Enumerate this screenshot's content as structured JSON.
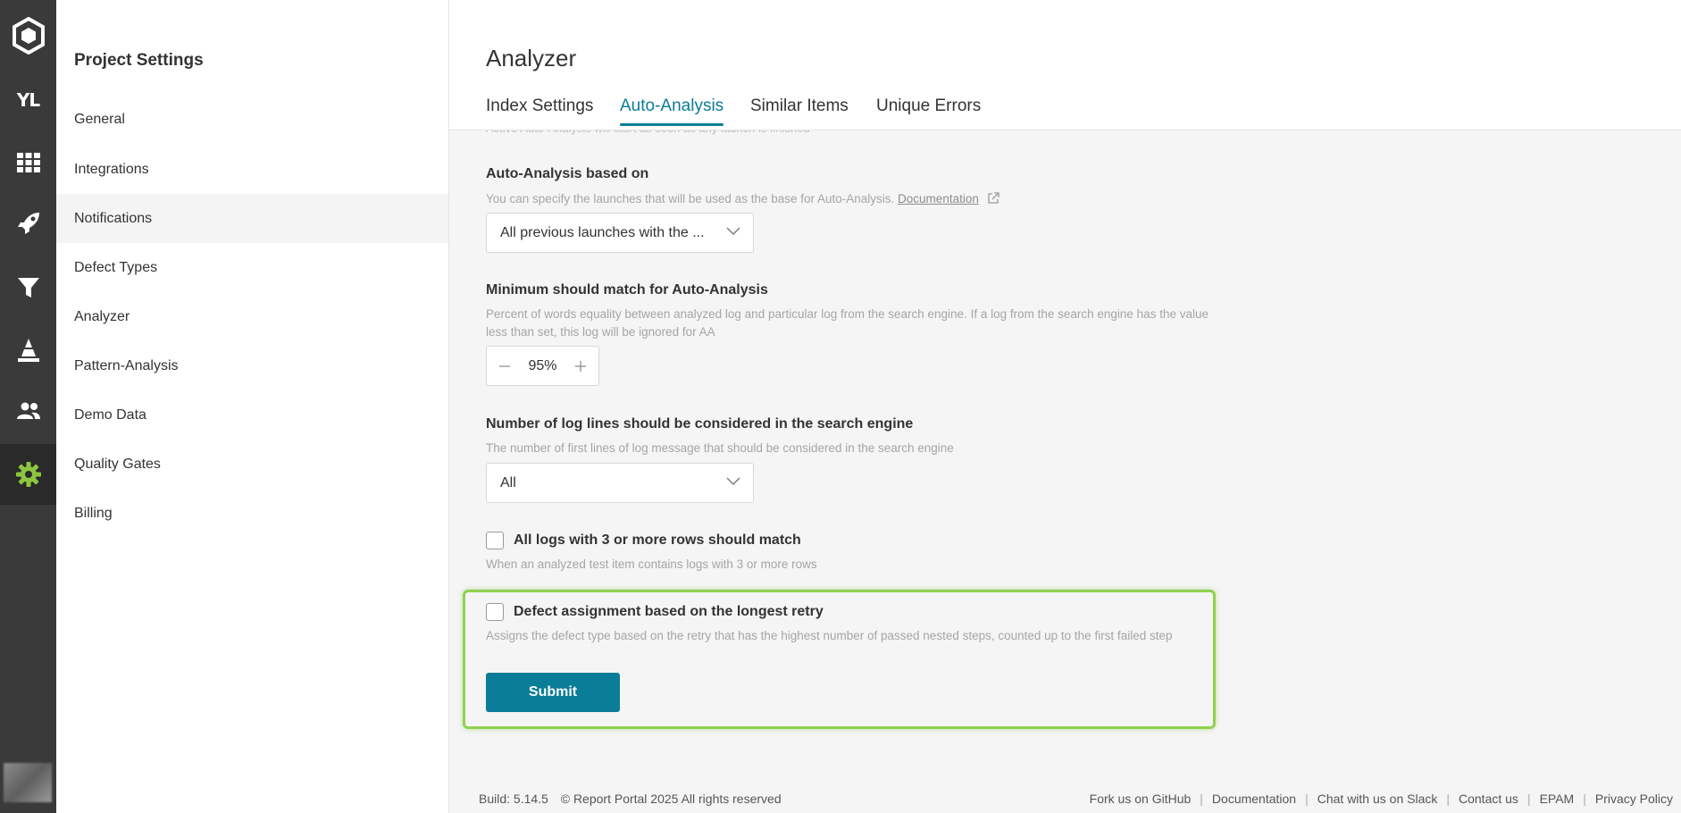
{
  "rail": {
    "project_initials": "YL",
    "items": [
      {
        "name": "dashboard-icon"
      },
      {
        "name": "launches-icon"
      },
      {
        "name": "filters-icon"
      },
      {
        "name": "debug-icon"
      },
      {
        "name": "members-icon"
      },
      {
        "name": "settings-icon",
        "active": true
      }
    ],
    "accent": "#8dc63f"
  },
  "sidebar": {
    "title": "Project Settings",
    "items": [
      {
        "label": "General"
      },
      {
        "label": "Integrations"
      },
      {
        "label": "Notifications"
      },
      {
        "label": "Defect Types"
      },
      {
        "label": "Analyzer"
      },
      {
        "label": "Pattern-Analysis"
      },
      {
        "label": "Demo Data"
      },
      {
        "label": "Quality Gates"
      },
      {
        "label": "Billing"
      }
    ]
  },
  "header": {
    "title": "Analyzer",
    "tabs": [
      {
        "label": "Index Settings"
      },
      {
        "label": "Auto-Analysis",
        "active": true
      },
      {
        "label": "Similar Items"
      },
      {
        "label": "Unique Errors"
      }
    ]
  },
  "form": {
    "clipped_hint": "Active Auto-Analysis will start as soon as any launch is finished",
    "based_on": {
      "label": "Auto-Analysis based on",
      "description": "You can specify the launches that will be used as the base for Auto-Analysis.",
      "link_text": "Documentation",
      "value": "All previous launches with the ..."
    },
    "min_match": {
      "label": "Minimum should match for Auto-Analysis",
      "description": "Percent of words equality between analyzed log and particular log from the search engine. If a log from the search engine has the value less than set, this log will be ignored for AA",
      "value": "95%"
    },
    "log_lines": {
      "label": "Number of log lines should be considered in the search engine",
      "description": "The number of first lines of log message that should be considered in the search engine",
      "value": "All"
    },
    "all_logs": {
      "label": "All logs with 3 or more rows should match",
      "description": "When an analyzed test item contains logs with 3 or more rows",
      "checked": false
    },
    "longest_retry": {
      "label": "Defect assignment based on the longest retry",
      "description": "Assigns the defect type based on the retry that has the highest number of passed nested steps, counted up to the first failed step",
      "checked": false
    },
    "submit_label": "Submit"
  },
  "footer": {
    "build": "Build: 5.14.5",
    "copyright": "© Report Portal 2025 All rights reserved",
    "links": [
      {
        "label": "Fork us on GitHub"
      },
      {
        "label": "Documentation"
      },
      {
        "label": "Chat with us on Slack"
      },
      {
        "label": "Contact us"
      },
      {
        "label": "EPAM"
      },
      {
        "label": "Privacy Policy"
      }
    ]
  },
  "colors": {
    "primary": "#0a7d98",
    "highlight": "#8fd14f",
    "rail": "#3a3a3a"
  }
}
